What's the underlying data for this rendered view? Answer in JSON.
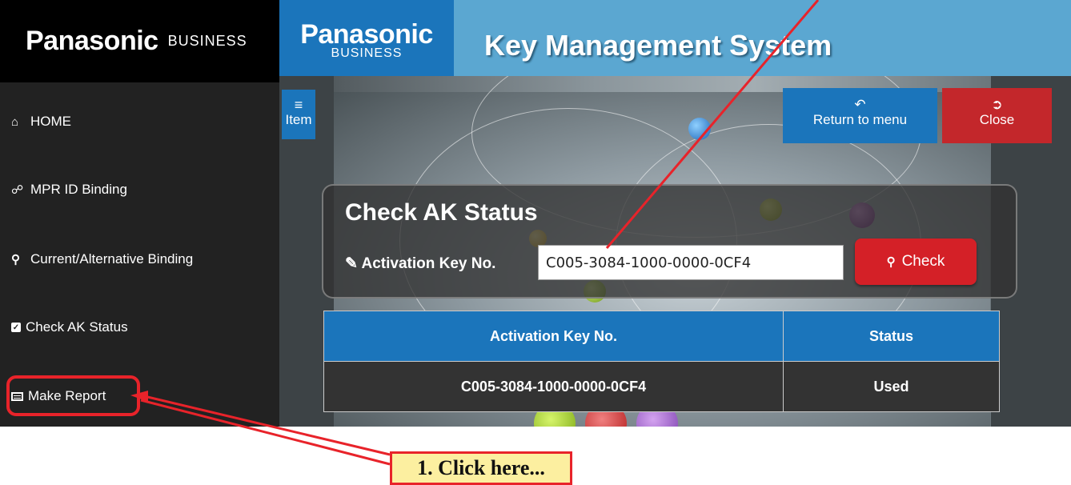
{
  "sidebar": {
    "brand": "Panasonic",
    "brand_sub": "BUSINESS",
    "items": [
      {
        "label": "HOME",
        "icon": "home-icon"
      },
      {
        "label": "MPR ID Binding",
        "icon": "link-icon"
      },
      {
        "label": "Current/Alternative Binding",
        "icon": "search-icon"
      },
      {
        "label": "Check AK Status",
        "icon": "checkbox-icon"
      },
      {
        "label": "Make Report",
        "icon": "report-icon"
      }
    ]
  },
  "header": {
    "brand": "Panasonic",
    "brand_sub": "BUSINESS",
    "title": "Key Management System"
  },
  "toolbar": {
    "item_label": "Item",
    "return_label": "Return to menu",
    "close_label": "Close"
  },
  "check_panel": {
    "title": "Check AK Status",
    "ak_label": "Activation Key No.",
    "ak_value": "C005-3084-1000-0000-0CF4",
    "check_label": "Check"
  },
  "results": {
    "headers": [
      "Activation Key No.",
      "Status"
    ],
    "rows": [
      [
        "C005-3084-1000-0000-0CF4",
        "Used"
      ]
    ]
  },
  "annotation": {
    "callout_text": "1. Click here...",
    "color": "#e8232a"
  }
}
